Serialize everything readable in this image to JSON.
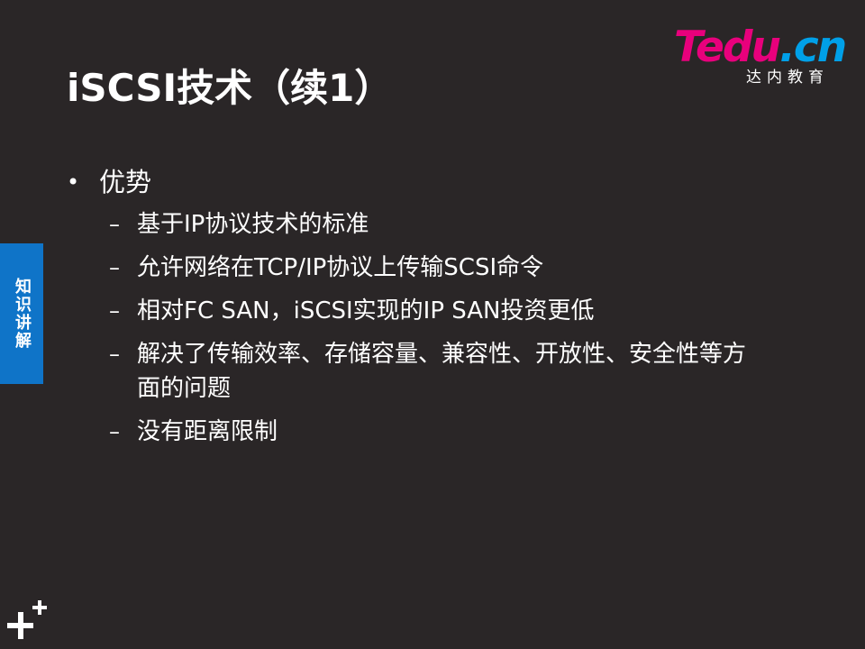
{
  "title": "iSCSI技术（续1）",
  "logo": {
    "brand_t": "T",
    "brand_edu": "edu",
    "brand_cn": ".cn",
    "tagline": "达内教育"
  },
  "side_tab": {
    "label": "知识讲解"
  },
  "content": {
    "bullet_symbol": "•",
    "main_bullet": "优势",
    "dash_symbol": "–",
    "subitems": [
      "基于IP协议技术的标准",
      "允许网络在TCP/IP协议上传输SCSI命令",
      "相对FC SAN，iSCSI实现的IP SAN投资更低",
      "解决了传输效率、存储容量、兼容性、开放性、安全性等方面的问题",
      "没有距离限制"
    ]
  },
  "colors": {
    "background": "#2a2627",
    "text": "#ffffff",
    "accent_blue": "#0f74c8",
    "logo_pink": "#e8007c",
    "logo_blue": "#00a0e8"
  },
  "icons": {
    "corner_mark": "plus-mark-icon"
  }
}
